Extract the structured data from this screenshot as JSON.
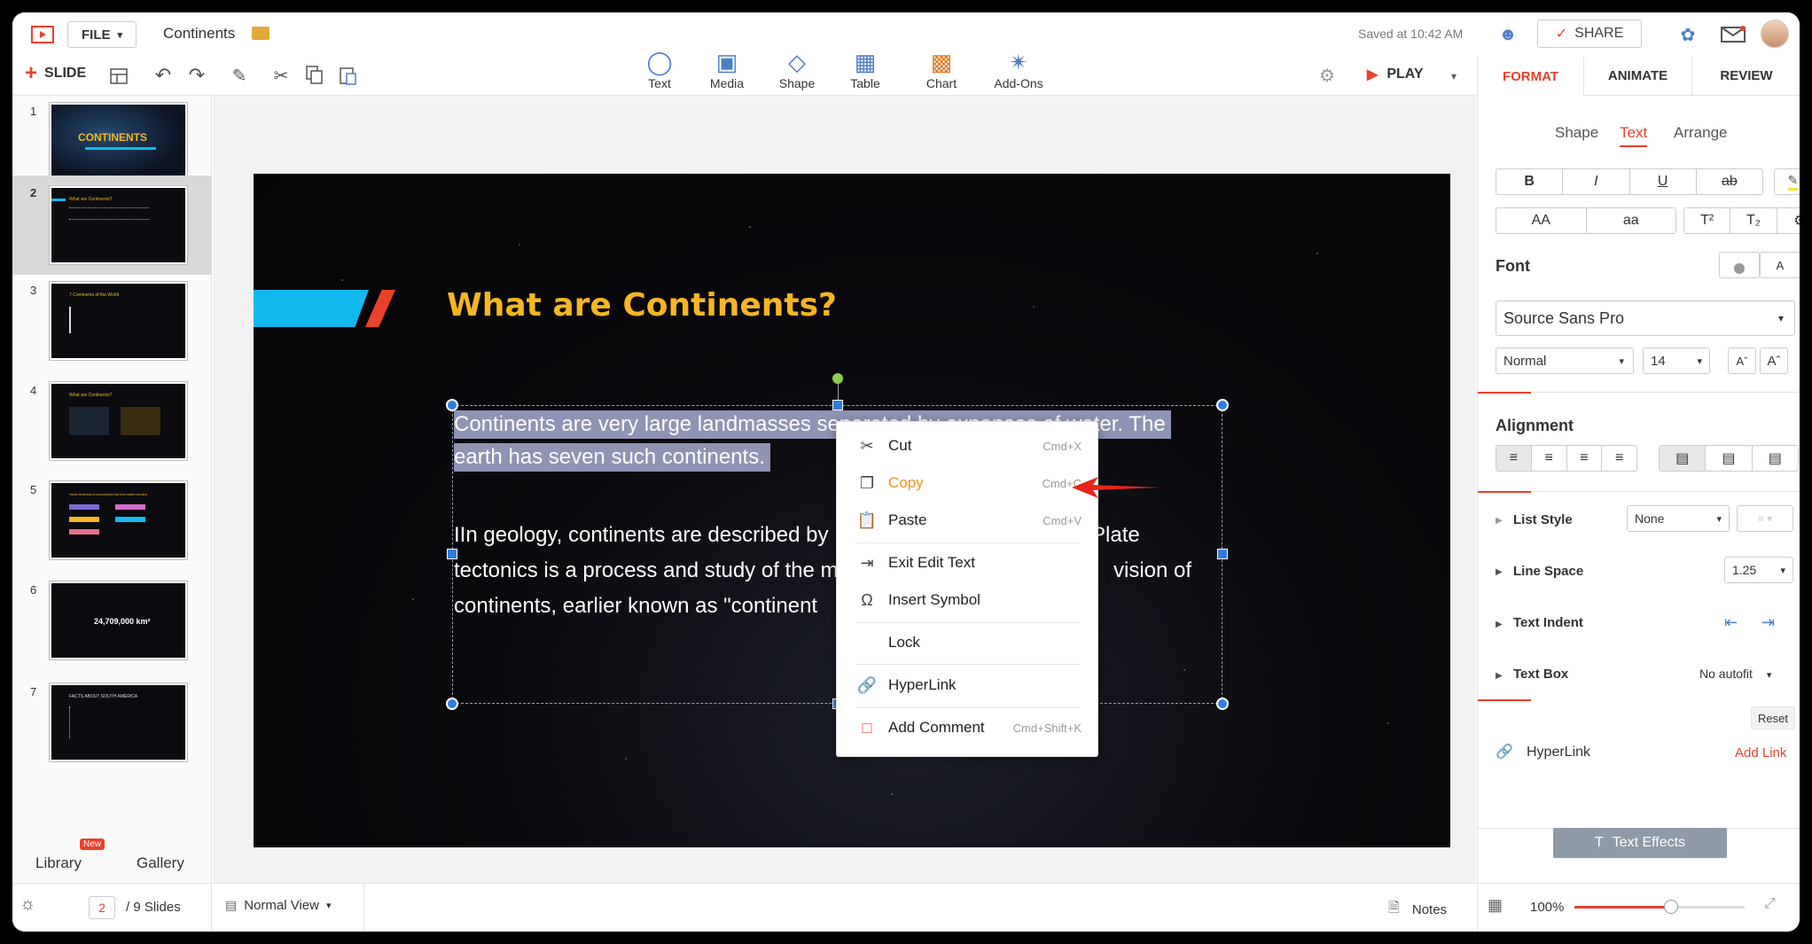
{
  "app": {
    "file_label": "FILE",
    "doc_title": "Continents",
    "saved_status": "Saved at 10:42 AM",
    "share_label": "SHARE",
    "slide_label": "SLIDE",
    "play_label": "PLAY"
  },
  "toolbar": {
    "insert_items": [
      {
        "label": "Text",
        "icon": "text-box-icon"
      },
      {
        "label": "Media",
        "icon": "media-icon"
      },
      {
        "label": "Shape",
        "icon": "shape-icon"
      },
      {
        "label": "Table",
        "icon": "table-icon"
      },
      {
        "label": "Chart",
        "icon": "chart-icon"
      },
      {
        "label": "Add-Ons",
        "icon": "add-ons-icon"
      }
    ]
  },
  "right_panel": {
    "tabs": [
      "FORMAT",
      "ANIMATE",
      "REVIEW"
    ],
    "subtabs": [
      "Shape",
      "Text",
      "Arrange"
    ],
    "active_tab": "FORMAT",
    "active_subtab": "Text",
    "font_heading": "Font",
    "font_family": "Source Sans Pro",
    "font_style": "Normal",
    "font_size": "14",
    "alignment_heading": "Alignment",
    "list_style_label": "List Style",
    "list_style_value": "None",
    "line_space_label": "Line Space",
    "line_space_value": "1.25",
    "text_indent_label": "Text Indent",
    "text_box_label": "Text Box",
    "text_box_value": "No autofit",
    "reset_label": "Reset",
    "hyperlink_label": "HyperLink",
    "add_link_label": "Add Link",
    "text_effects_label": "Text Effects",
    "accent_color": "#e8412c"
  },
  "left_panel": {
    "slides": [
      {
        "num": "1",
        "title": "CONTINENTS"
      },
      {
        "num": "2",
        "title": "What are Continents?"
      },
      {
        "num": "3",
        "title": "7 Continents of the World"
      },
      {
        "num": "4",
        "title": "What are Continents?"
      },
      {
        "num": "5",
        "title": "North America is surrounded by four water bodies"
      },
      {
        "num": "6",
        "title": "24,709,000 km²"
      },
      {
        "num": "7",
        "title": "FACTS ABOUT SOUTH AMERICA"
      }
    ],
    "selected_slide": 2,
    "library_label": "Library",
    "library_badge": "New",
    "gallery_label": "Gallery"
  },
  "slide": {
    "title": "What are Continents?",
    "para1_line1": "Continents are very large landmasses separated by expanses of water. The",
    "para1_line2": "earth has seven such continents.",
    "para2_line1": "IIn geology, continents are described by",
    "para2_line1_end": "Plate",
    "para2_line2": "tectonics is a process and study of the m",
    "para2_line2_end": "vision of",
    "para2_line3": "continents, earlier known as \"continent",
    "title_color": "#f6b622",
    "accent_blue": "#12b9ee",
    "accent_red": "#e8412c"
  },
  "context_menu": {
    "items": [
      {
        "label": "Cut",
        "shortcut": "Cmd+X",
        "icon": "scissors-icon"
      },
      {
        "label": "Copy",
        "shortcut": "Cmd+C",
        "icon": "copy-icon"
      },
      {
        "label": "Paste",
        "shortcut": "Cmd+V",
        "icon": "paste-icon"
      },
      {
        "label": "Exit Edit Text",
        "shortcut": "",
        "icon": "exit-edit-icon"
      },
      {
        "label": "Insert Symbol",
        "shortcut": "",
        "icon": "omega-icon"
      },
      {
        "label": "Lock",
        "shortcut": "",
        "icon": ""
      },
      {
        "label": "HyperLink",
        "shortcut": "",
        "icon": "link-icon"
      },
      {
        "label": "Add Comment",
        "shortcut": "Cmd+Shift+K",
        "icon": "comment-icon"
      }
    ],
    "highlight_color": "#f0902a"
  },
  "status_bar": {
    "current_slide": "2",
    "total_slides": "/ 9 Slides",
    "view_mode": "Normal View",
    "notes_label": "Notes",
    "zoom": "100%",
    "zoom_fraction": 0.57
  }
}
